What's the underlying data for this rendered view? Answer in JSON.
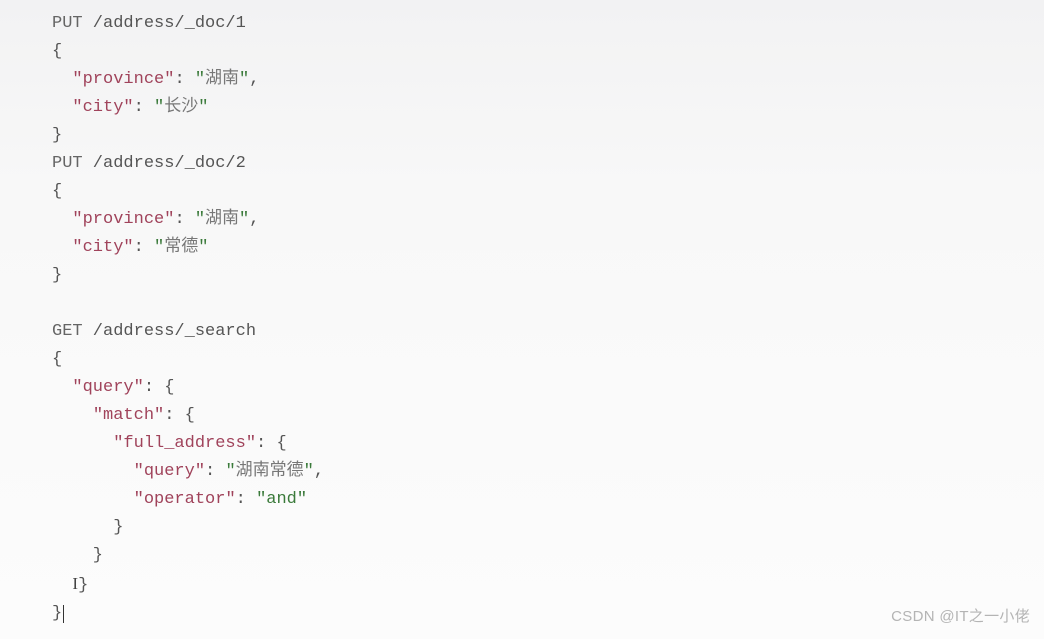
{
  "code": {
    "l1_method": "PUT",
    "l1_path": " /address/_doc/1",
    "l2": "{",
    "l3_indent": "  ",
    "l3_key": "\"province\"",
    "l3_colon": ": ",
    "l3_q1": "\"",
    "l3_val": "湖南",
    "l3_q2": "\"",
    "l3_comma": ",",
    "l4_indent": "  ",
    "l4_key": "\"city\"",
    "l4_colon": ": ",
    "l4_q1": "\"",
    "l4_val": "长沙",
    "l4_q2": "\"",
    "l5": "}",
    "l6_method": "PUT",
    "l6_path": " /address/_doc/2",
    "l7": "{",
    "l8_indent": "  ",
    "l8_key": "\"province\"",
    "l8_colon": ": ",
    "l8_q1": "\"",
    "l8_val": "湖南",
    "l8_q2": "\"",
    "l8_comma": ",",
    "l9_indent": "  ",
    "l9_key": "\"city\"",
    "l9_colon": ": ",
    "l9_q1": "\"",
    "l9_val": "常德",
    "l9_q2": "\"",
    "l10": "}",
    "l11": "",
    "l12_method": "GET",
    "l12_path": " /address/_search",
    "l13": "{",
    "l14_indent": "  ",
    "l14_key": "\"query\"",
    "l14_after": ": {",
    "l15_indent": "    ",
    "l15_key": "\"match\"",
    "l15_after": ": {",
    "l16_indent": "      ",
    "l16_key": "\"full_address\"",
    "l16_after": ": {",
    "l17_indent": "        ",
    "l17_key": "\"query\"",
    "l17_colon": ": ",
    "l17_q1": "\"",
    "l17_val": "湖南常德",
    "l17_q2": "\"",
    "l17_comma": ",",
    "l18_indent": "        ",
    "l18_key": "\"operator\"",
    "l18_colon": ": ",
    "l18_val": "\"and\"",
    "l19": "      }",
    "l20": "    }",
    "l21_pre": "  ",
    "l21_after": "}",
    "l22": "}"
  },
  "watermark": "CSDN @IT之一小佬"
}
